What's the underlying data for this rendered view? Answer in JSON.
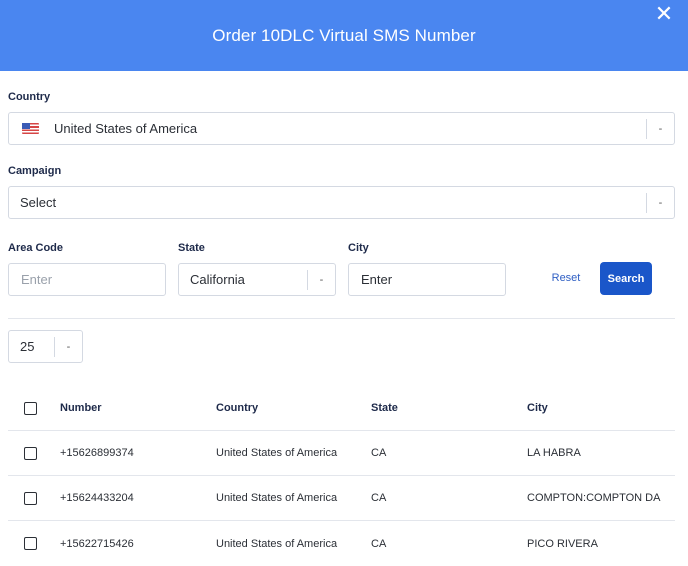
{
  "dialog": {
    "title": "Order 10DLC Virtual SMS Number",
    "close_symbol": "✕",
    "header_color": "#4a86f0"
  },
  "country": {
    "label": "Country",
    "value": "United States of America",
    "flag_icon": "us-flag-icon",
    "arrow": "-"
  },
  "campaign": {
    "label": "Campaign",
    "value": "Select",
    "arrow": "-"
  },
  "filters": {
    "area_code": {
      "label": "Area Code",
      "placeholder": "Enter"
    },
    "state": {
      "label": "State",
      "value": "California",
      "arrow": "-"
    },
    "city": {
      "label": "City",
      "placeholder": "Enter"
    },
    "reset_label": "Reset",
    "search_label": "Search"
  },
  "page_size": {
    "value": "25",
    "arrow": "-"
  },
  "table": {
    "headers": {
      "number": "Number",
      "country": "Country",
      "state": "State",
      "city": "City"
    },
    "rows": [
      {
        "number": "+15626899374",
        "country": "United States of America",
        "state": "CA",
        "city": "LA HABRA"
      },
      {
        "number": "+15624433204",
        "country": "United States of America",
        "state": "CA",
        "city": "COMPTON:COMPTON DA"
      },
      {
        "number": "+15622715426",
        "country": "United States of America",
        "state": "CA",
        "city": "PICO RIVERA"
      }
    ]
  },
  "colors": {
    "primary_button": "#1a56c9",
    "link": "#2f5fc4"
  }
}
